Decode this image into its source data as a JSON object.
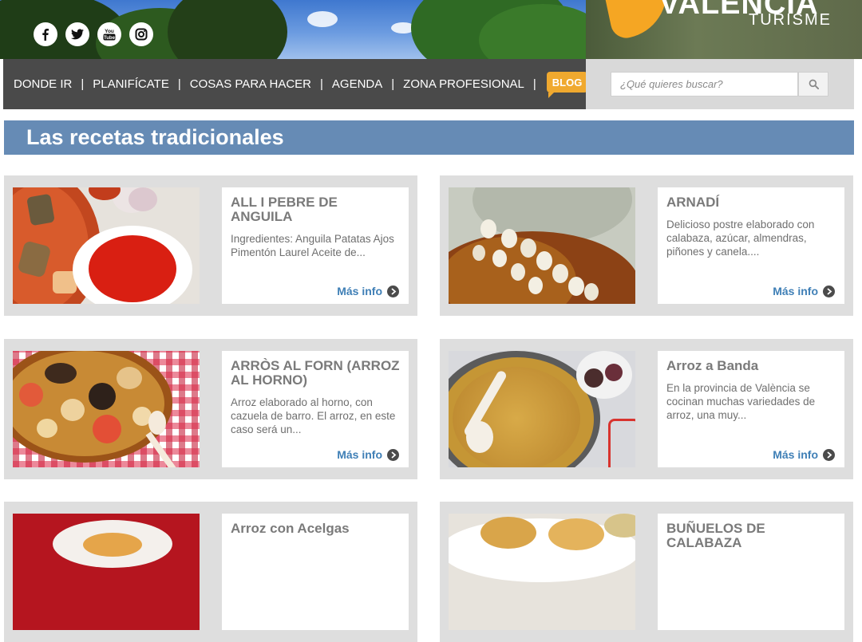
{
  "brand": {
    "logo_text": "VALÈNCIA",
    "logo_sub": "TURISME"
  },
  "social": [
    {
      "name": "facebook-icon",
      "glyph": "f"
    },
    {
      "name": "twitter-icon",
      "glyph": "t"
    },
    {
      "name": "youtube-icon",
      "glyph": "You\nTube"
    },
    {
      "name": "instagram-icon",
      "glyph": "ig"
    }
  ],
  "nav": {
    "items": [
      "DONDE IR",
      "PLANIFÍCATE",
      "COSAS PARA HACER",
      "AGENDA",
      "ZONA PROFESIONAL"
    ],
    "separator": "|",
    "blog": "BLOG"
  },
  "search": {
    "placeholder": "¿Qué quieres buscar?",
    "icon": "search-icon"
  },
  "page_title": "Las recetas tradicionales",
  "more_label": "Más info",
  "recipes": [
    {
      "title": "ALL I PEBRE DE ANGUILA",
      "description": "Ingredientes: Anguila Patatas Ajos Pimentón Laurel Aceite de..."
    },
    {
      "title": "ARNADÍ",
      "description": "Delicioso postre elaborado con calabaza, azúcar, almendras, piñones y canela...."
    },
    {
      "title": "ARRÒS AL FORN (ARROZ AL HORNO)",
      "description": "Arroz elaborado al horno, con cazuela de barro. El arroz, en este caso será un..."
    },
    {
      "title": "Arroz a Banda",
      "description": "En la provincia de València se cocinan muchas variedades de arroz, una muy..."
    },
    {
      "title": "Arroz con Acelgas",
      "description": ""
    },
    {
      "title": "BUÑUELOS DE CALABAZA",
      "description": ""
    }
  ],
  "colors": {
    "nav_bg": "#4a4a4a",
    "title_bar": "#668bb5",
    "blog_badge": "#f0a92f",
    "link": "#3f7fb6",
    "card_bg": "#dedede"
  }
}
